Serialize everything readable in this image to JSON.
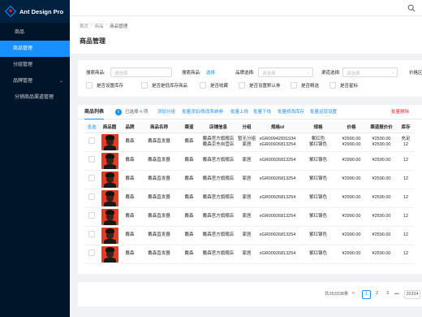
{
  "app": {
    "name": "Ant Design Pro"
  },
  "sidebar": {
    "items": [
      {
        "label": "商品"
      },
      {
        "label": "商品管理"
      },
      {
        "label": "分组管理"
      },
      {
        "label": "品牌管理"
      },
      {
        "label": "分销商品渠道管理"
      }
    ]
  },
  "breadcrumb": {
    "home": "首页",
    "section": "商品",
    "current": "商品管理"
  },
  "page": {
    "title": "商品管理"
  },
  "filters": {
    "search_goods_label": "搜索商品:",
    "search_goods_placeholder": "请选择",
    "search_goods2_label": "搜索商品:",
    "search_goods2_link": "选择",
    "brand_label": "品牌选择:",
    "brand_placeholder": "请选择",
    "channel_label": "渠道选择:",
    "channel_placeholder": "请选择",
    "price_label": "价格区间",
    "checkboxes": [
      "是否设置库存",
      "是否是低库存商品",
      "是否收藏",
      "是否设置默认券",
      "是否精选",
      "是否星标"
    ]
  },
  "table_header": {
    "tab": "商品列表",
    "info_icon": "i",
    "selected_prefix": "已选择",
    "selected_count": "4",
    "selected_suffix": "项",
    "actions": [
      "添加分组",
      "批量添加/修改系统券",
      "批量上线",
      "批量下线",
      "批量修改库存",
      "批量运现设置"
    ],
    "danger_action": "批量删除"
  },
  "columns": [
    "全选",
    "商品图",
    "品牌",
    "商品名称",
    "渠道",
    "店铺信息",
    "分组",
    "规格id",
    "规格",
    "价格",
    "渠道报价价",
    "库存"
  ],
  "rows": [
    {
      "brand": "戴森",
      "name": "戴森直发器",
      "channel": "戴森",
      "shop": "戴森官方旗舰店\n戴森京东自营店",
      "group": "暂无分组\n家居",
      "spec_id": "xGR00942931934\nxGR00926813254",
      "spec": "紫红色\n紫红镍色",
      "price": "¥2990.00\n¥2990.00",
      "channel_price": "¥2590.00\n¥2590.00",
      "stock": "充足\n12"
    },
    {
      "brand": "戴森",
      "name": "戴森直发器",
      "channel": "戴森",
      "shop": "戴森官方旗舰店",
      "group": "家居",
      "spec_id": "xGR00926813254",
      "spec": "紫红镍色",
      "price": "¥2990.00",
      "channel_price": "¥2590.00",
      "stock": "12"
    },
    {
      "brand": "戴森",
      "name": "戴森直发器",
      "channel": "戴森",
      "shop": "戴森官方旗舰店",
      "group": "家居",
      "spec_id": "xGR00926813254",
      "spec": "紫红镍色",
      "price": "¥2990.00",
      "channel_price": "¥2590.00",
      "stock": "12"
    },
    {
      "brand": "戴森",
      "name": "戴森直发器",
      "channel": "戴森",
      "shop": "戴森官方旗舰店",
      "group": "家居",
      "spec_id": "xGR00926813254",
      "spec": "紫红镍色",
      "price": "¥2990.00",
      "channel_price": "¥2590.00",
      "stock": "12"
    },
    {
      "brand": "戴森",
      "name": "戴森直发器",
      "channel": "戴森",
      "shop": "戴森官方旗舰店",
      "group": "家居",
      "spec_id": "xGR00926813254",
      "spec": "紫红镍色",
      "price": "¥2990.00",
      "channel_price": "¥2590.00",
      "stock": "12"
    },
    {
      "brand": "戴森",
      "name": "戴森直发器",
      "channel": "戴森",
      "shop": "戴森官方旗舰店",
      "group": "家居",
      "spec_id": "xGR00926813254",
      "spec": "紫红镍色",
      "price": "¥2990.00",
      "channel_price": "¥2590.00",
      "stock": "12"
    },
    {
      "brand": "戴森",
      "name": "戴森直发器",
      "channel": "戴森",
      "shop": "戴森官方旗舰店",
      "group": "家居",
      "spec_id": "xGR00926813254",
      "spec": "紫红镍色",
      "price": "¥2990.00",
      "channel_price": "¥2590.00",
      "stock": "12"
    }
  ],
  "pagination": {
    "total": "共263338条",
    "prev": "<",
    "pages": [
      "1",
      "2",
      "3"
    ],
    "ellipsis": "•••",
    "last": "26334",
    "current": "1"
  },
  "colors": {
    "primary": "#1890ff",
    "sidebar": "#001529",
    "danger": "#f5222d"
  }
}
